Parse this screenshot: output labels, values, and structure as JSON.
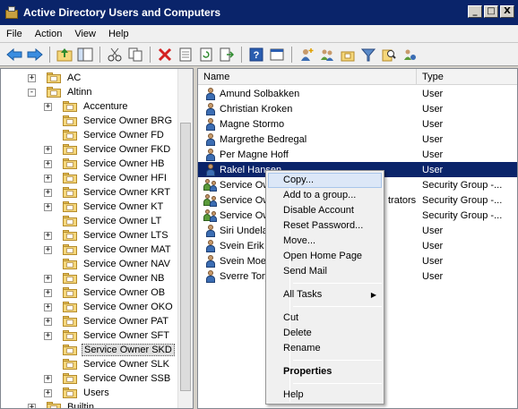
{
  "window": {
    "title": "Active Directory Users and Computers",
    "buttons": {
      "minimize": "_",
      "maximize": "□",
      "close": "X"
    }
  },
  "menubar": [
    "File",
    "Action",
    "View",
    "Help"
  ],
  "toolbar": {
    "icons": [
      "back-arrow-icon",
      "forward-arrow-icon",
      "up-folder-icon",
      "show-tree-icon",
      "cut-icon",
      "copy-icon",
      "delete-icon",
      "properties-icon",
      "refresh-icon",
      "export-list-icon",
      "help-icon",
      "console-tree-icon",
      "new-user-icon",
      "new-group-icon",
      "new-ou-icon",
      "filter-icon",
      "find-icon",
      "add-to-group-icon"
    ]
  },
  "tree": {
    "items": [
      {
        "label": "AC",
        "expander": "+"
      },
      {
        "label": "Altinn",
        "expander": "-"
      },
      {
        "label": "Accenture",
        "expander": "+"
      },
      {
        "label": "Service Owner BRG",
        "expander": ""
      },
      {
        "label": "Service Owner FD",
        "expander": ""
      },
      {
        "label": "Service Owner FKD",
        "expander": "+"
      },
      {
        "label": "Service Owner HB",
        "expander": "+"
      },
      {
        "label": "Service Owner HFI",
        "expander": "+"
      },
      {
        "label": "Service Owner KRT",
        "expander": "+"
      },
      {
        "label": "Service Owner KT",
        "expander": "+"
      },
      {
        "label": "Service Owner LT",
        "expander": ""
      },
      {
        "label": "Service Owner LTS",
        "expander": "+"
      },
      {
        "label": "Service Owner MAT",
        "expander": "+"
      },
      {
        "label": "Service Owner NAV",
        "expander": ""
      },
      {
        "label": "Service Owner NB",
        "expander": "+"
      },
      {
        "label": "Service Owner OB",
        "expander": "+"
      },
      {
        "label": "Service Owner OKO",
        "expander": "+"
      },
      {
        "label": "Service Owner PAT",
        "expander": "+"
      },
      {
        "label": "Service Owner SFT",
        "expander": "+"
      },
      {
        "label": "Service Owner SKD",
        "expander": "",
        "selected": true
      },
      {
        "label": "Service Owner SLK",
        "expander": ""
      },
      {
        "label": "Service Owner SSB",
        "expander": "+"
      },
      {
        "label": "Users",
        "expander": "+"
      },
      {
        "label": "Builtin",
        "expander": "+"
      }
    ]
  },
  "list": {
    "columns": [
      "Name",
      "Type"
    ],
    "rows": [
      {
        "name": "Amund Solbakken",
        "type": "User",
        "icon": "user-icon"
      },
      {
        "name": "Christian Kroken",
        "type": "User",
        "icon": "user-icon"
      },
      {
        "name": "Magne Stormo",
        "type": "User",
        "icon": "user-icon"
      },
      {
        "name": "Margrethe Bedregal",
        "type": "User",
        "icon": "user-icon"
      },
      {
        "name": "Per Magne Hoff",
        "type": "User",
        "icon": "user-icon"
      },
      {
        "name": "Rakel Hansen",
        "type": "User",
        "icon": "user-icon",
        "selected": true
      },
      {
        "name": "Service Ow",
        "type": "Security Group -...",
        "icon": "group-icon"
      },
      {
        "name": "Service Ow",
        "type": "Security Group -...",
        "icon": "group-icon",
        "overflow": "trators"
      },
      {
        "name": "Service Ow",
        "type": "Security Group -...",
        "icon": "group-icon"
      },
      {
        "name": "Siri Undelan",
        "type": "User",
        "icon": "user-icon"
      },
      {
        "name": "Svein Erik D",
        "type": "User",
        "icon": "user-icon"
      },
      {
        "name": "Svein Moen",
        "type": "User",
        "icon": "user-icon"
      },
      {
        "name": "Sverre Tory",
        "type": "User",
        "icon": "user-icon"
      }
    ]
  },
  "context_menu": {
    "items": [
      {
        "label": "Copy...",
        "hover": true
      },
      {
        "label": "Add to a group..."
      },
      {
        "label": "Disable Account"
      },
      {
        "label": "Reset Password..."
      },
      {
        "label": "Move..."
      },
      {
        "label": "Open Home Page"
      },
      {
        "label": "Send Mail"
      },
      {
        "sep": true
      },
      {
        "label": "All Tasks",
        "submenu": "▶"
      },
      {
        "sep": true
      },
      {
        "label": "Cut"
      },
      {
        "label": "Delete"
      },
      {
        "label": "Rename"
      },
      {
        "sep": true
      },
      {
        "label": "Properties",
        "bold": true
      },
      {
        "sep": true
      },
      {
        "label": "Help"
      }
    ]
  }
}
